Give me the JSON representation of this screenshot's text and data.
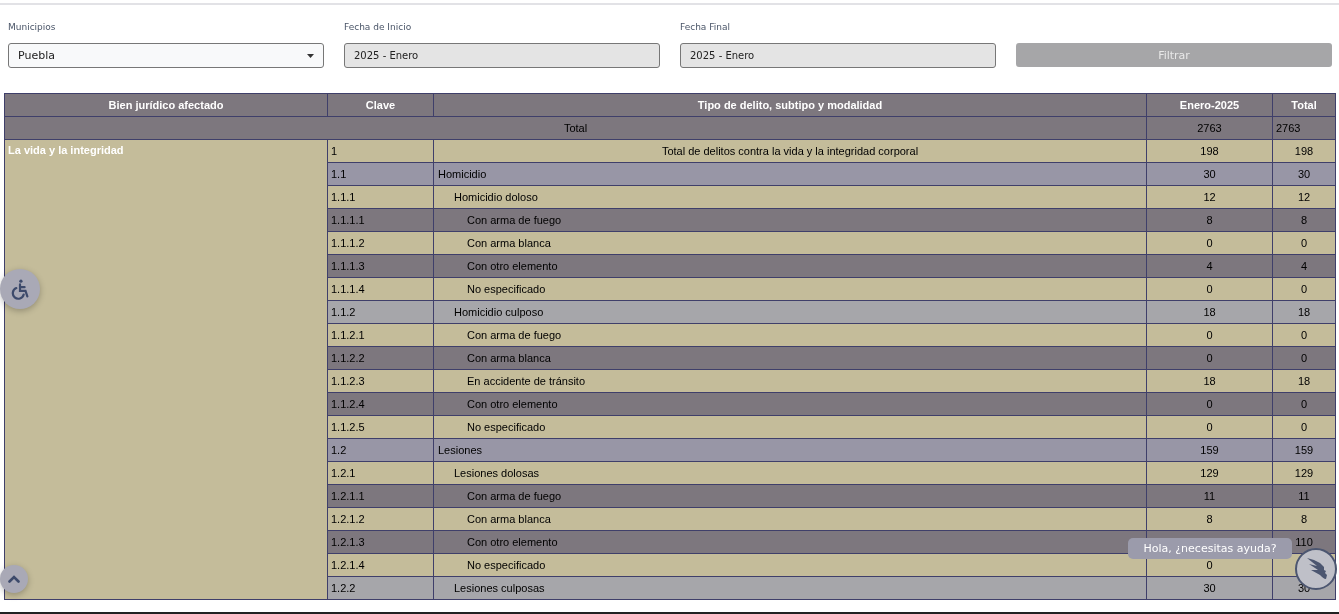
{
  "filters": [
    {
      "kind": "select",
      "label": "Municipios",
      "value": "Puebla"
    },
    {
      "kind": "readonly",
      "label": "Fecha de Inicio",
      "value": "2025 - Enero"
    },
    {
      "kind": "readonly",
      "label": "Fecha Final",
      "value": "2025 - Enero"
    }
  ],
  "filter_button": {
    "label": "Filtrar",
    "disabled": true
  },
  "table": {
    "columns": [
      "Bien jurídico afectado",
      "Clave",
      "Tipo de delito, subtipo y modalidad",
      "Enero-2025",
      "Total"
    ],
    "total_row": {
      "label": "Total",
      "enero": "2763",
      "total": "2763"
    },
    "groups": [
      {
        "bien": "La vida y la integridad",
        "rows": [
          {
            "clave": "1",
            "tipo": "Total de delitos contra la vida y la integridad corporal",
            "enero": "198",
            "total": "198",
            "color": "#c4bc9a",
            "children": [
              {
                "clave": "1.1",
                "tipo": "Homicidio",
                "enero": "30",
                "total": "30",
                "color": "#9896a6",
                "children": [
                  {
                    "clave": "1.1.1",
                    "tipo": "Homicidio doloso",
                    "enero": "12",
                    "total": "12",
                    "color": "#c4bc9a",
                    "children": [
                      {
                        "clave": "1.1.1.1",
                        "tipo": "Con arma de fuego",
                        "enero": "8",
                        "total": "8",
                        "color": "#7d777e"
                      },
                      {
                        "clave": "1.1.1.2",
                        "tipo": "Con arma blanca",
                        "enero": "0",
                        "total": "0",
                        "color": "#c4bc9a"
                      },
                      {
                        "clave": "1.1.1.3",
                        "tipo": "Con otro elemento",
                        "enero": "4",
                        "total": "4",
                        "color": "#7d777e"
                      },
                      {
                        "clave": "1.1.1.4",
                        "tipo": "No especificado",
                        "enero": "0",
                        "total": "0",
                        "color": "#c4bc9a"
                      }
                    ]
                  },
                  {
                    "clave": "1.1.2",
                    "tipo": "Homicidio culposo",
                    "enero": "18",
                    "total": "18",
                    "color": "#a6a6aa",
                    "children": [
                      {
                        "clave": "1.1.2.1",
                        "tipo": "Con arma de fuego",
                        "enero": "0",
                        "total": "0",
                        "color": "#c4bc9a"
                      },
                      {
                        "clave": "1.1.2.2",
                        "tipo": "Con arma blanca",
                        "enero": "0",
                        "total": "0",
                        "color": "#7d777e"
                      },
                      {
                        "clave": "1.1.2.3",
                        "tipo": "En accidente de tránsito",
                        "enero": "18",
                        "total": "18",
                        "color": "#c4bc9a"
                      },
                      {
                        "clave": "1.1.2.4",
                        "tipo": "Con otro elemento",
                        "enero": "0",
                        "total": "0",
                        "color": "#7d777e"
                      },
                      {
                        "clave": "1.1.2.5",
                        "tipo": "No especificado",
                        "enero": "0",
                        "total": "0",
                        "color": "#c4bc9a"
                      }
                    ]
                  }
                ]
              },
              {
                "clave": "1.2",
                "tipo": "Lesiones",
                "enero": "159",
                "total": "159",
                "color": "#9896a6",
                "children": [
                  {
                    "clave": "1.2.1",
                    "tipo": "Lesiones dolosas",
                    "enero": "129",
                    "total": "129",
                    "color": "#c4bc9a",
                    "children": [
                      {
                        "clave": "1.2.1.1",
                        "tipo": "Con arma de fuego",
                        "enero": "11",
                        "total": "11",
                        "color": "#7d777e"
                      },
                      {
                        "clave": "1.2.1.2",
                        "tipo": "Con arma blanca",
                        "enero": "8",
                        "total": "8",
                        "color": "#c4bc9a"
                      },
                      {
                        "clave": "1.2.1.3",
                        "tipo": "Con otro elemento",
                        "total": "110",
                        "color": "#7d777e"
                      },
                      {
                        "clave": "1.2.1.4",
                        "tipo": "No especificado",
                        "enero": "0",
                        "color": "#c4bc9a"
                      }
                    ]
                  },
                  {
                    "clave": "1.2.2",
                    "tipo": "Lesiones culposas",
                    "enero": "30",
                    "total": "30",
                    "color": "#a6a6aa"
                  }
                ]
              }
            ]
          }
        ]
      }
    ]
  },
  "chat": {
    "greeting": "Hola, ¿necesitas ayuda?"
  }
}
